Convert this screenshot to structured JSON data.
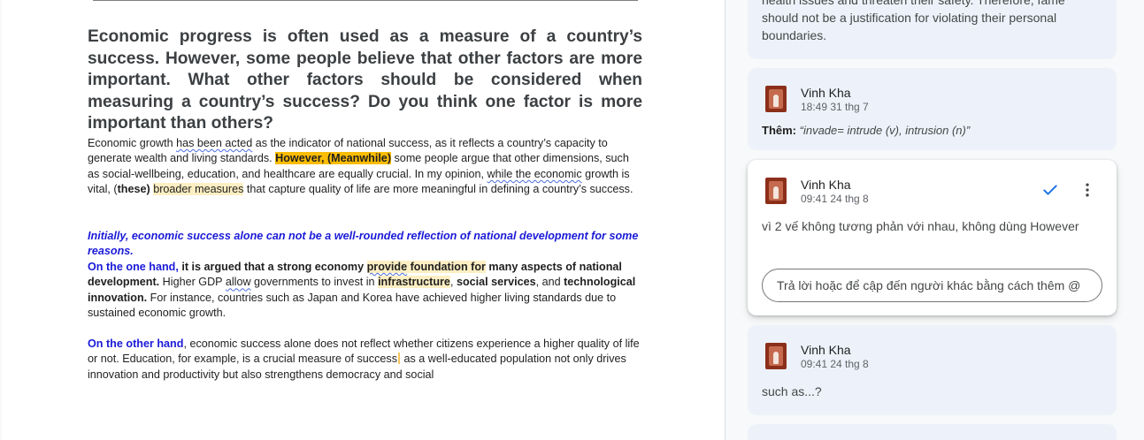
{
  "document": {
    "prompt": "Economic progress is often used as a measure of a country’s success. However, some people believe that other factors are more important. What other factors should be considered when measuring a country’s success? Do you think one factor is more important than others?",
    "intro": {
      "a": "Economic growth ",
      "b": "has been acted",
      "c": " as the indicator of national success, as it reflects a country’s capacity to generate wealth and living standards. ",
      "d": "However, (Meanwhile)",
      "e": " some people argue that other dimensions, such as social-wellbeing, education, and healthcare are equally crucial. In my opinion, ",
      "f": "while the economic",
      "g": " growth is vital, (",
      "h": "these)",
      "i": " ",
      "j": "broader measures",
      "k": " that capture quality of life are more meaningful in defining a country’s success."
    },
    "body1": {
      "topic": "Initially, economic success alone can not be a well-rounded reflection of national development for some reasons.",
      "oneHand": "On the one hand, ",
      "b1": " it is argued that a strong economy ",
      "b2": "provide",
      "b3": " foundation for",
      "b4": " many aspects of national development.",
      "b5": " Higher GDP ",
      "b6": "allow",
      "b7": " governments to invest in ",
      "b8": "infrastructure",
      "b9": ", ",
      "b10": "social services",
      "b11": ", and ",
      "b12": "technological innovation.",
      "b13": " For instance, countries such as Japan and Korea have achieved higher living standards due to sustained economic growth."
    },
    "body2": {
      "otherHand": "On the other hand",
      "c1": ", economic success alone does not reflect whether citizens experience a higher quality of life or not. Education, for example, is a crucial measure of success",
      "c2": " as a well-educated population not only drives innovation and productivity but also strengthens democracy and social"
    }
  },
  "comments": {
    "top": {
      "text": "health issues and threaten their safety. Therefore, fame should not be a justification for violating their personal boundaries."
    },
    "c2": {
      "author": "Vinh Kha",
      "time": "18:49 31 thg 7",
      "suggestLabel": "Thêm:",
      "suggestValue": "“invade= intrude (v), intrusion (n)”"
    },
    "c3": {
      "author": "Vinh Kha",
      "time": "09:41 24 thg 8",
      "text": "vì 2 vế không tương phản với nhau, không dùng However",
      "replyPlaceholder": "Trả lời hoặc để cập đến người khác bằng cách thêm @"
    },
    "c4": {
      "author": "Vinh Kha",
      "time": "09:41 24 thg 8",
      "text": "such as...?"
    }
  },
  "icons": {
    "resolve": "check-icon",
    "more": "more-vert-icon",
    "avatar": "avatar-image"
  },
  "colors": {
    "accent": "#1a73e8",
    "highlight_orange": "#fbbc04",
    "highlight_cream": "#fdefc3",
    "text_blue": "#1a1ad8",
    "card_bg": "#edf2fa"
  }
}
